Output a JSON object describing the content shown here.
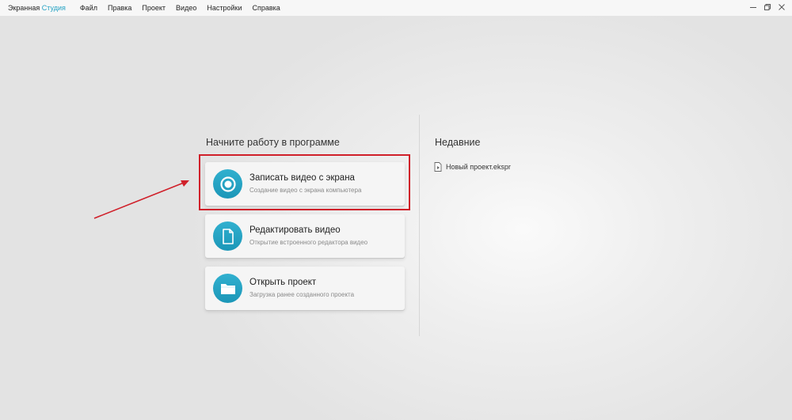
{
  "app": {
    "title_main": "Экранная",
    "title_accent": "Студия"
  },
  "menu": {
    "items": [
      "Файл",
      "Правка",
      "Проект",
      "Видео",
      "Настройки",
      "Справка"
    ]
  },
  "window_controls": {
    "minimize_icon": "minimize-icon",
    "restore_icon": "restore-icon",
    "close_icon": "close-icon"
  },
  "start": {
    "title": "Начните работу в программе",
    "cards": [
      {
        "title": "Записать видео с экрана",
        "subtitle": "Создание видео с экрана компьютера",
        "icon": "record-icon"
      },
      {
        "title": "Редактировать видео",
        "subtitle": "Открытие встроенного редактора видео",
        "icon": "document-icon"
      },
      {
        "title": "Открыть проект",
        "subtitle": "Загрузка ранее созданного проекта",
        "icon": "folder-icon"
      }
    ]
  },
  "recent": {
    "title": "Недавние",
    "items": [
      {
        "name": "Новый проект.ekspr",
        "icon": "project-file-icon"
      }
    ]
  },
  "colors": {
    "accent": "#26a3c4",
    "highlight": "#d0202a"
  }
}
